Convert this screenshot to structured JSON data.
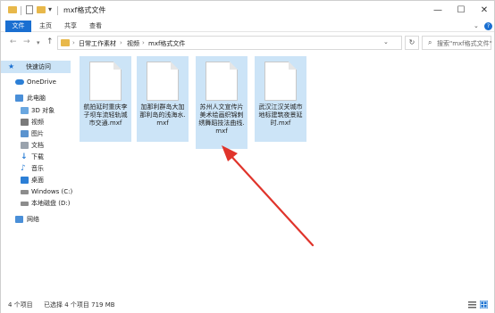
{
  "window": {
    "title": "mxf格式文件"
  },
  "ribbon": {
    "tabs": [
      "文件",
      "主页",
      "共享",
      "查看"
    ]
  },
  "address": {
    "segments": [
      "日常工作素材",
      "视频",
      "mxf格式文件"
    ],
    "search_placeholder": "搜索\"mxf格式文件\""
  },
  "nav": {
    "quick_access": "快速访问",
    "onedrive": "OneDrive",
    "this_pc": "此电脑",
    "items": [
      "3D 对象",
      "视频",
      "图片",
      "文档",
      "下载",
      "音乐",
      "桌面",
      "Windows (C:)",
      "本地磁盘 (D:)"
    ],
    "network": "网络"
  },
  "files": [
    {
      "name": "航拍延时重庆李子坝车流轻轨城市交通.mxf"
    },
    {
      "name": "加那利群岛大加那利岛的浅海水.mxf"
    },
    {
      "name": "苏州人文宣传片美术绘画织锦刺绣舞蹈技法曲线.mxf"
    },
    {
      "name": "武汉江汉关城市地标建筑夜景延时.mxf"
    }
  ],
  "status": {
    "item_count": "4 个项目",
    "selected": "已选择 4 个项目  719 MB"
  },
  "colors": {
    "accent": "#1a6fd1",
    "selection": "#cce4f7",
    "arrow": "#e0342b",
    "folder": "#e8b84a"
  }
}
